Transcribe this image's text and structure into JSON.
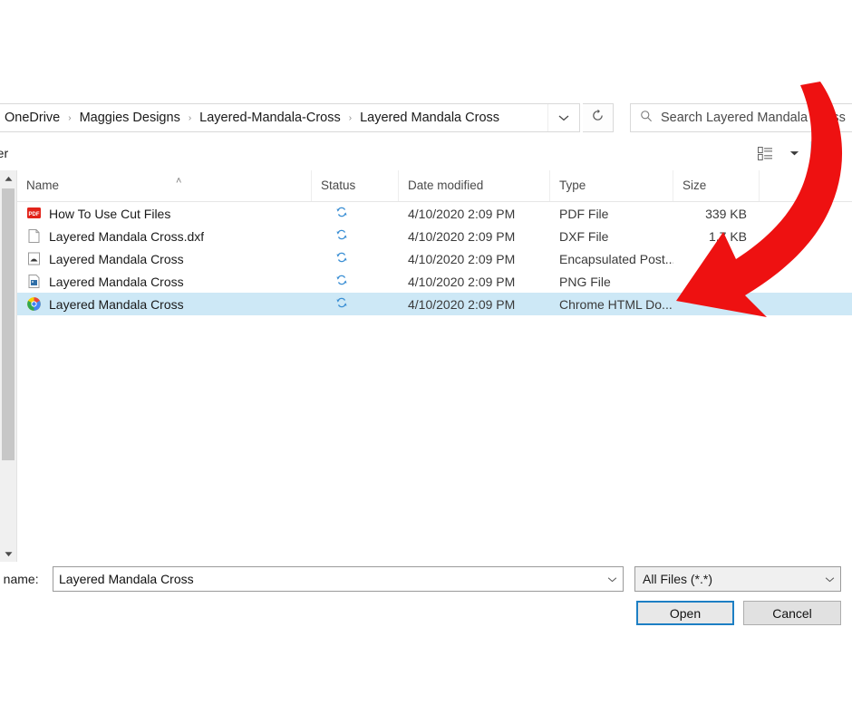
{
  "colors": {
    "annotation_arrow": "#ee1111",
    "selection": "#cde8f6",
    "focus_border": "#1d7fc4",
    "status_sync": "#3b8fd4",
    "pdf_icon": "#e2231a"
  },
  "address_bar": {
    "breadcrumbs": [
      {
        "label": "OneDrive"
      },
      {
        "label": "Maggies Designs"
      },
      {
        "label": "Layered-Mandala-Cross"
      },
      {
        "label": "Layered Mandala Cross"
      }
    ],
    "separator": "›",
    "dropdown_icon": "chevron-down-icon",
    "refresh_icon": "refresh-icon",
    "search": {
      "icon": "search-icon",
      "placeholder": "Search Layered Mandala Cross",
      "value": ""
    }
  },
  "toolbar": {
    "new_folder_label": "older",
    "view_options_icon": "view-list-icon",
    "view_dropdown_icon": "chevron-down-icon",
    "preview_pane_icon": "preview-pane-icon"
  },
  "file_list": {
    "columns": [
      {
        "key": "name",
        "label": "Name",
        "sorted": "asc"
      },
      {
        "key": "status",
        "label": "Status"
      },
      {
        "key": "date",
        "label": "Date modified"
      },
      {
        "key": "type",
        "label": "Type"
      },
      {
        "key": "size",
        "label": "Size"
      }
    ],
    "sort_caret": "˄",
    "rows": [
      {
        "name": "How To Use Cut Files",
        "icon": "pdf-file-icon",
        "status": "sync-icon",
        "date": "4/10/2020 2:09 PM",
        "type": "PDF File",
        "size": "339 KB",
        "selected": false
      },
      {
        "name": "Layered Mandala Cross.dxf",
        "icon": "generic-file-icon",
        "status": "sync-icon",
        "date": "4/10/2020 2:09 PM",
        "type": "DXF File",
        "size": "1,7 KB",
        "selected": false
      },
      {
        "name": "Layered Mandala Cross",
        "icon": "eps-file-icon",
        "status": "sync-icon",
        "date": "4/10/2020 2:09 PM",
        "type": "Encapsulated Post...",
        "size": "",
        "selected": false
      },
      {
        "name": "Layered Mandala Cross",
        "icon": "png-file-icon",
        "status": "sync-icon",
        "date": "4/10/2020 2:09 PM",
        "type": "PNG File",
        "size": "",
        "selected": false
      },
      {
        "name": "Layered Mandala Cross",
        "icon": "chrome-file-icon",
        "status": "sync-icon",
        "date": "4/10/2020 2:09 PM",
        "type": "Chrome HTML Do...",
        "size": "",
        "selected": true
      }
    ]
  },
  "bottom_bar": {
    "file_name_label": "e name:",
    "file_name_value": "Layered Mandala Cross",
    "file_name_dropdown_icon": "chevron-down-icon",
    "filter_value": "All Files (*.*)",
    "filter_dropdown_icon": "chevron-down-icon",
    "open_button": "Open",
    "cancel_button": "Cancel"
  },
  "annotation": {
    "type": "curved-arrow",
    "points_to": "selected file row",
    "color": "#ee1111"
  }
}
